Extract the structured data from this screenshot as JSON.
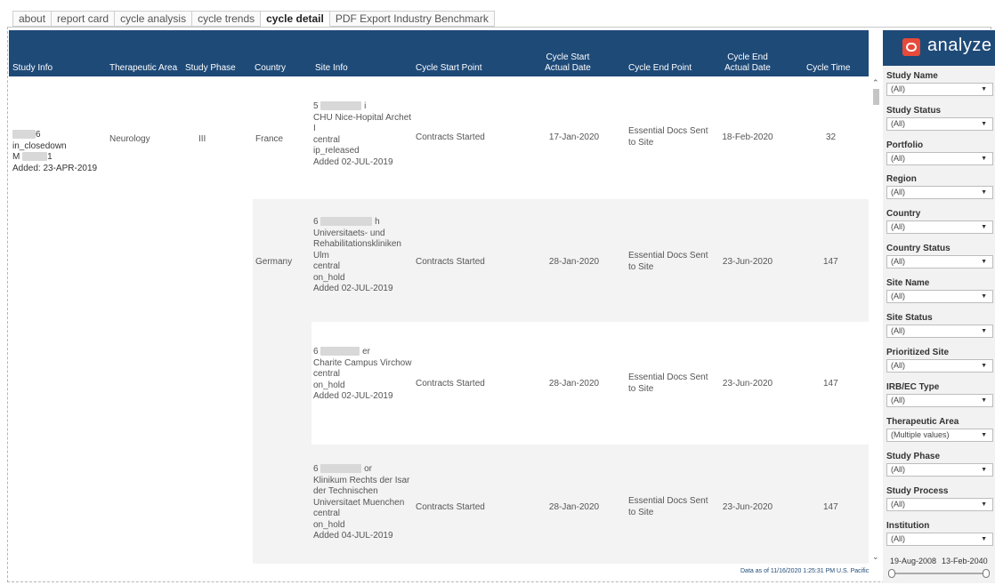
{
  "tabs": [
    {
      "label": "about"
    },
    {
      "label": "report card"
    },
    {
      "label": "cycle analysis"
    },
    {
      "label": "cycle trends"
    },
    {
      "label": "cycle detail"
    },
    {
      "label": "PDF Export Industry Benchmark"
    }
  ],
  "active_tab": "cycle detail",
  "table": {
    "headers": {
      "study_info": "Study Info",
      "therapeutic_area": "Therapeutic Area",
      "study_phase": "Study Phase",
      "country": "Country",
      "site_info": "Site Info",
      "cycle_start_point": "Cycle Start Point",
      "cycle_start_actual_date": "Cycle Start Actual Date",
      "cycle_end_point": "Cycle End Point",
      "cycle_end_actual_date": "Cycle End Actual Date",
      "cycle_time": "Cycle Time"
    },
    "study": {
      "line1_suffix": "6",
      "line2": "in_closedown",
      "line3_prefix": "M",
      "line3_suffix": "1",
      "added": "Added: 23-APR-2019",
      "therapeutic_area": "Neurology",
      "study_phase": "III"
    },
    "countries": [
      "France",
      "Germany"
    ],
    "rows": [
      {
        "site_id_prefix": "5",
        "site_id_suffix": "i",
        "site_name": "CHU Nice-Hopital Archet I",
        "region": "central",
        "status": "ip_released",
        "added": "Added 02-JUL-2019",
        "start_point": "Contracts Started",
        "start_date": "17-Jan-2020",
        "end_point": "Essential Docs Sent to Site",
        "end_date": "18-Feb-2020",
        "cycle_time": "32"
      },
      {
        "site_id_prefix": "6",
        "site_id_suffix": "h",
        "site_name": "Universitaets- und Rehabilitationskliniken Ulm",
        "region": "central",
        "status": "on_hold",
        "added": "Added 02-JUL-2019",
        "start_point": "Contracts Started",
        "start_date": "28-Jan-2020",
        "end_point": "Essential Docs Sent to Site",
        "end_date": "23-Jun-2020",
        "cycle_time": "147"
      },
      {
        "site_id_prefix": "6",
        "site_id_suffix": "er",
        "site_name": "Charite Campus Virchow",
        "region": "central",
        "status": "on_hold",
        "added": "Added 02-JUL-2019",
        "start_point": "Contracts Started",
        "start_date": "28-Jan-2020",
        "end_point": "Essential Docs Sent to Site",
        "end_date": "23-Jun-2020",
        "cycle_time": "147"
      },
      {
        "site_id_prefix": "6",
        "site_id_suffix": "or",
        "site_name": "Klinikum Rechts der Isar der Technischen Universitaet Muenchen",
        "region": "central",
        "status": "on_hold",
        "added": "Added 04-JUL-2019",
        "start_point": "Contracts Started",
        "start_date": "28-Jan-2020",
        "end_point": "Essential Docs Sent to Site",
        "end_date": "23-Jun-2020",
        "cycle_time": "147"
      }
    ]
  },
  "footer_note": "Data as of 11/16/2020 1:25:31 PM U.S. Pacific",
  "panel": {
    "title": "analyze",
    "filters": [
      {
        "label": "Study Name",
        "value": "(All)"
      },
      {
        "label": "Study Status",
        "value": "(All)"
      },
      {
        "label": "Portfolio",
        "value": "(All)"
      },
      {
        "label": "Region",
        "value": "(All)"
      },
      {
        "label": "Country",
        "value": "(All)"
      },
      {
        "label": "Country Status",
        "value": "(All)"
      },
      {
        "label": "Site Name",
        "value": "(All)"
      },
      {
        "label": "Site Status",
        "value": "(All)"
      },
      {
        "label": "Prioritized Site",
        "value": "(All)"
      },
      {
        "label": "IRB/EC Type",
        "value": "(All)"
      },
      {
        "label": "Therapeutic Area",
        "value": "(Multiple values)"
      },
      {
        "label": "Study Phase",
        "value": "(All)"
      },
      {
        "label": "Study Process",
        "value": "(All)"
      },
      {
        "label": "Institution",
        "value": "(All)"
      }
    ],
    "date_range": {
      "start": "19-Aug-2008",
      "end": "13-Feb-2040"
    }
  },
  "colors": {
    "header_bg": "#1e4a78",
    "logo_accent": "#e64a3a",
    "panel_bg": "#f2f2f2"
  }
}
